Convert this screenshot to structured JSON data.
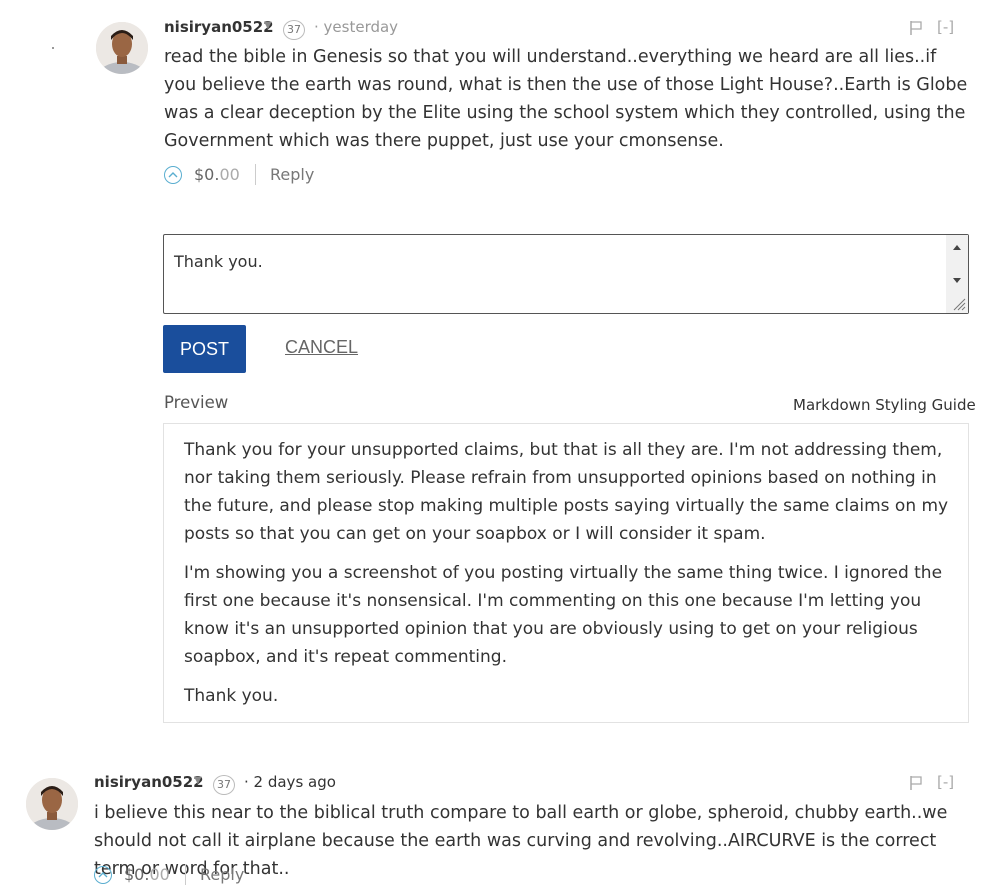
{
  "comments": [
    {
      "author": "nisiryan0522",
      "reputation": "37",
      "time": "· yesterday",
      "flag_icon": "flag-icon",
      "collapse": "[-]",
      "body": "read the bible in Genesis so that you will understand..everything we heard are all lies..if you believe the earth was round, what is then the use of those Light House?..Earth is Globe was a clear deception by the Elite using the school system which they controlled, using the Government which was there puppet, just use your cmonsense.",
      "payout_dollars": "$0.",
      "payout_cents": "00",
      "reply": "Reply"
    },
    {
      "author": "nisiryan0522",
      "reputation": "37",
      "time": "· 2 days ago",
      "flag_icon": "flag-icon",
      "collapse": "[-]",
      "body": "i believe this near to the biblical truth compare to ball earth or globe, spheroid, chubby earth..we should not call it airplane because the earth was curving and revolving..AIRCURVE is the correct term or word for that..",
      "payout_dollars": "$0.",
      "payout_cents": "00",
      "reply": "Reply"
    }
  ],
  "reply_form": {
    "textarea_value": "Thank you.",
    "post_label": "POST",
    "cancel_label": "CANCEL",
    "preview_label": "Preview",
    "markdown_guide": "Markdown Styling Guide",
    "preview_paragraphs": [
      "Thank you for your unsupported claims, but that is all they are. I'm not addressing them, nor taking them seriously. Please refrain from unsupported opinions based on nothing in the future, and please stop making multiple posts saying virtually the same claims on my posts so that you can get on your soapbox or I will consider it spam.",
      "I'm showing you a screenshot of you posting virtually the same thing twice. I ignored the first one because it's nonsensical. I'm commenting on this one because I'm letting you know it's an unsupported opinion that you are obviously using to get on your religious soapbox, and it's repeat commenting.",
      "Thank you."
    ]
  },
  "colors": {
    "post_button": "#1a4e9c",
    "upvote_ring": "#5aaed0"
  }
}
